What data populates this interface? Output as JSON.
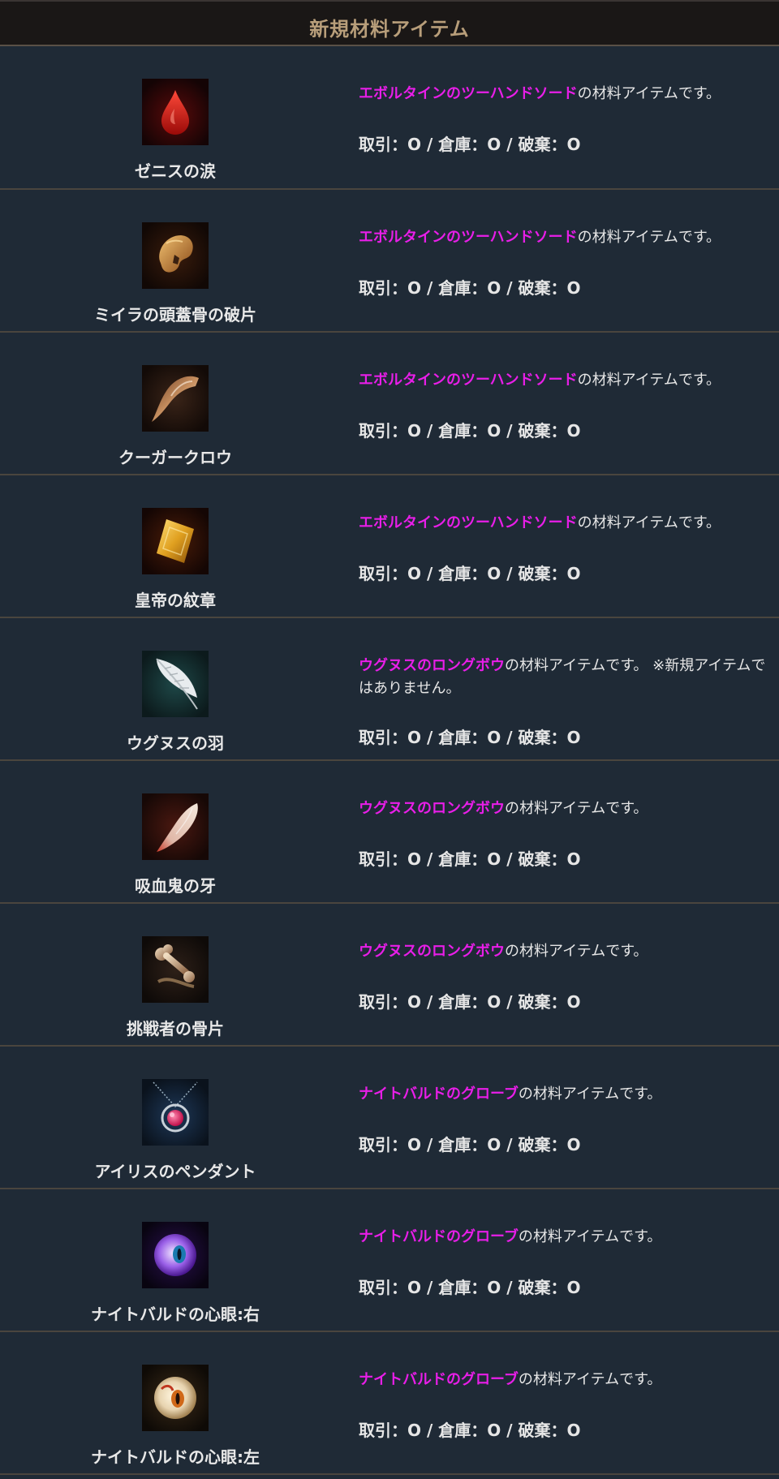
{
  "header": {
    "title": "新規材料アイテム"
  },
  "items": [
    {
      "icon": "red-tear-icon",
      "name": "ゼニスの涙",
      "weapon": "エボルタインのツーハンドソード",
      "suffix": "の材料アイテムです。",
      "flags": "取引：O / 倉庫：O / 破棄：O"
    },
    {
      "icon": "skull-fragment-icon",
      "name": "ミイラの頭蓋骨の破片",
      "weapon": "エボルタインのツーハンドソード",
      "suffix": "の材料アイテムです。",
      "flags": "取引：O / 倉庫：O / 破棄：O"
    },
    {
      "icon": "claw-icon",
      "name": "クーガークロウ",
      "weapon": "エボルタインのツーハンドソード",
      "suffix": "の材料アイテムです。",
      "flags": "取引：O / 倉庫：O / 破棄：O"
    },
    {
      "icon": "gold-emblem-icon",
      "name": "皇帝の紋章",
      "weapon": "エボルタインのツーハンドソード",
      "suffix": "の材料アイテムです。",
      "flags": "取引：O / 倉庫：O / 破棄：O"
    },
    {
      "icon": "feather-icon",
      "name": "ウグヌスの羽",
      "weapon": "ウグヌスのロングボウ",
      "suffix": "の材料アイテムです。 ※新規アイテムではありません。",
      "flags": "取引：O / 倉庫：O / 破棄：O"
    },
    {
      "icon": "fang-icon",
      "name": "吸血鬼の牙",
      "weapon": "ウグヌスのロングボウ",
      "suffix": "の材料アイテムです。",
      "flags": "取引：O / 倉庫：O / 破棄：O"
    },
    {
      "icon": "bone-fragment-icon",
      "name": "挑戦者の骨片",
      "weapon": "ウグヌスのロングボウ",
      "suffix": "の材料アイテムです。",
      "flags": "取引：O / 倉庫：O / 破棄：O"
    },
    {
      "icon": "pendant-icon",
      "name": "アイリスのペンダント",
      "weapon": "ナイトバルドのグローブ",
      "suffix": "の材料アイテムです。",
      "flags": "取引：O / 倉庫：O / 破棄：O"
    },
    {
      "icon": "purple-eye-orb-icon",
      "name": "ナイトバルドの心眼:右",
      "weapon": "ナイトバルドのグローブ",
      "suffix": "の材料アイテムです。",
      "flags": "取引：O / 倉庫：O / 破棄：O"
    },
    {
      "icon": "amber-eye-orb-icon",
      "name": "ナイトバルドの心眼:左",
      "weapon": "ナイトバルドのグローブ",
      "suffix": "の材料アイテムです。",
      "flags": "取引：O / 倉庫：O / 破棄：O"
    }
  ],
  "colors": {
    "background": "#1f2a36",
    "header_background": "#1a1716",
    "header_text": "#b89e7a",
    "link": "#e81ee8",
    "divider": "#4a453e"
  }
}
